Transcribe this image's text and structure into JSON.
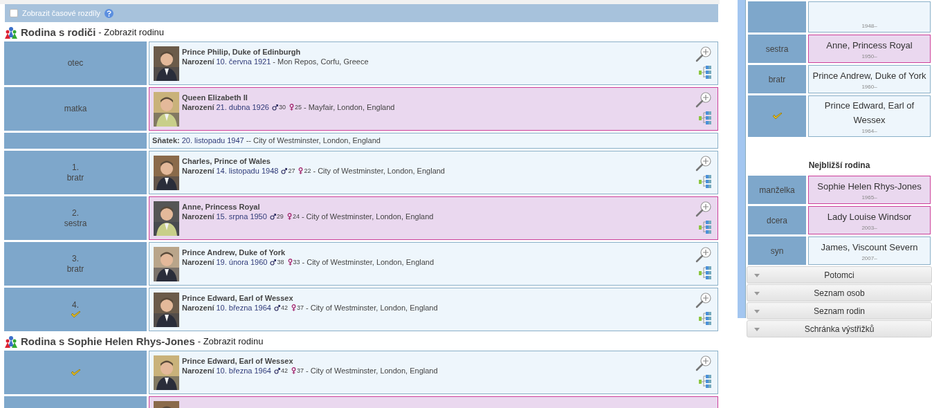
{
  "header": {
    "checkbox_label": "Zobrazit časové rozdíly",
    "checked": false
  },
  "families": [
    {
      "title": "Rodina s rodiči",
      "subtitle": "- Zobrazit rodinu",
      "rows": [
        {
          "kind": "person",
          "relation": "otec",
          "current": false,
          "female": false,
          "name": "Prince Philip, Duke of Edinburgh",
          "birth_label": "Narození",
          "birth_date": "10. června 1921",
          "place": "- Mon Repos, Corfu, Greece"
        },
        {
          "kind": "person",
          "relation": "matka",
          "current": false,
          "female": true,
          "name": "Queen Elizabeth II",
          "birth_label": "Narození",
          "birth_date": "21. dubna 1926",
          "father_age": "30",
          "mother_age": "25",
          "place": "- Mayfair, London, England"
        },
        {
          "kind": "marriage",
          "label": "Sňatek:",
          "date": "20. listopadu 1947",
          "place": "-- City of Westminster, London, England"
        },
        {
          "kind": "person",
          "number": "1.",
          "relation": "bratr",
          "current": false,
          "female": false,
          "name": "Charles, Prince of Wales",
          "birth_label": "Narození",
          "birth_date": "14. listopadu 1948",
          "father_age": "27",
          "mother_age": "22",
          "place": "- City of Westminster, London, England"
        },
        {
          "kind": "person",
          "number": "2.",
          "relation": "sestra",
          "current": false,
          "female": true,
          "name": "Anne, Princess Royal",
          "birth_label": "Narození",
          "birth_date": "15. srpna 1950",
          "father_age": "29",
          "mother_age": "24",
          "place": "- City of Westminster, London, England"
        },
        {
          "kind": "person",
          "number": "3.",
          "relation": "bratr",
          "current": false,
          "female": false,
          "name": "Prince Andrew, Duke of York",
          "birth_label": "Narození",
          "birth_date": "19. února 1960",
          "father_age": "38",
          "mother_age": "33",
          "place": "- City of Westminster, London, England"
        },
        {
          "kind": "person",
          "number": "4.",
          "current": true,
          "female": false,
          "name": "Prince Edward, Earl of Wessex",
          "birth_label": "Narození",
          "birth_date": "10. března 1964",
          "father_age": "42",
          "mother_age": "37",
          "place": "- City of Westminster, London, England"
        }
      ]
    },
    {
      "title": "Rodina s Sophie Helen Rhys-Jones",
      "subtitle": "- Zobrazit rodinu",
      "rows": [
        {
          "kind": "person",
          "current": true,
          "female": false,
          "name": "Prince Edward, Earl of Wessex",
          "birth_label": "Narození",
          "birth_date": "10. března 1964",
          "father_age": "42",
          "mother_age": "37",
          "place": "- City of Westminster, London, England"
        },
        {
          "kind": "person",
          "current": false,
          "female": true
        }
      ]
    }
  ],
  "sidebar": {
    "sections": [
      {
        "rows": [
          {
            "current": false,
            "female": false,
            "dates": "1948–"
          },
          {
            "relation": "sestra",
            "current": false,
            "female": true,
            "name": "Anne, Princess Royal",
            "dates": "1950–"
          },
          {
            "relation": "bratr",
            "current": false,
            "female": false,
            "name": "Prince Andrew, Duke of York",
            "dates": "1960–"
          },
          {
            "current": true,
            "female": false,
            "name": "Prince Edward, Earl of Wessex",
            "dates": "1964–"
          }
        ]
      },
      {
        "title": "Nejbližší rodina",
        "rows": [
          {
            "relation": "manželka",
            "current": false,
            "female": true,
            "name": "Sophie Helen Rhys-Jones",
            "dates": "1965–"
          },
          {
            "relation": "dcera",
            "current": false,
            "female": true,
            "name": "Lady Louise Windsor",
            "dates": "2003–"
          },
          {
            "relation": "syn",
            "current": false,
            "female": false,
            "name": "James, Viscount Severn",
            "dates": "2007–"
          }
        ]
      }
    ],
    "accordions": [
      {
        "label": "Potomci",
        "expanded": false
      },
      {
        "label": "Seznam osob",
        "expanded": false
      },
      {
        "label": "Seznam rodin",
        "expanded": false
      },
      {
        "label": "Schránka výstřižků",
        "expanded": false
      }
    ]
  }
}
